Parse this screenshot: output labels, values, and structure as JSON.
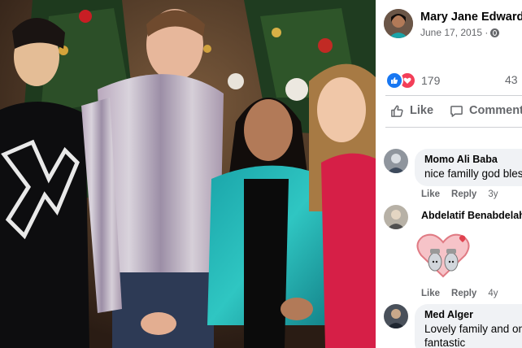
{
  "photo": {
    "description_icon": "photo-image"
  },
  "post": {
    "author": "Mary Jane Edwards",
    "date": "June 17, 2015 ·",
    "privacy_icon": "globe-icon"
  },
  "reactions": {
    "count": "179",
    "comments_count": "43"
  },
  "actions": {
    "like_label": "Like",
    "comment_label": "Comment"
  },
  "comments": [
    {
      "name": "Momo Ali Baba",
      "text": "nice familly god bless",
      "like": "Like",
      "reply": "Reply",
      "time": "3y"
    },
    {
      "name": "Abdelatif Benabdelah",
      "text": "",
      "like": "Like",
      "reply": "Reply",
      "time": "4y"
    },
    {
      "name": "Med Alger",
      "text": "Lovely family and on",
      "text2": "fantastic",
      "like": "",
      "reply": "",
      "time": ""
    }
  ],
  "colors": {
    "accent": "#1877f2",
    "love": "#f33e58",
    "muted": "#65676b"
  }
}
